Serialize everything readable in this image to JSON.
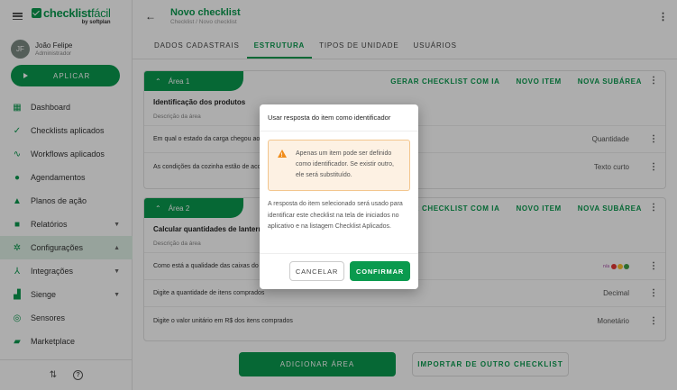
{
  "brand": {
    "logo_main": "checklist",
    "logo_light": "fácil",
    "logo_sub": "by softplan"
  },
  "user": {
    "initials": "JF",
    "name": "João Felipe",
    "role": "Administrador"
  },
  "sidebar": {
    "apply_label": "APLICAR",
    "items": [
      {
        "label": "Dashboard",
        "icon": "dashboard-icon"
      },
      {
        "label": "Checklists aplicados",
        "icon": "check-icon"
      },
      {
        "label": "Workflows aplicados",
        "icon": "trend-icon"
      },
      {
        "label": "Agendamentos",
        "icon": "clock-icon"
      },
      {
        "label": "Planos de ação",
        "icon": "warning-icon"
      },
      {
        "label": "Relatórios",
        "icon": "report-icon"
      },
      {
        "label": "Configurações",
        "icon": "gear-icon"
      },
      {
        "label": "Integrações",
        "icon": "integration-icon"
      },
      {
        "label": "Sienge",
        "icon": "building-icon"
      },
      {
        "label": "Sensores",
        "icon": "sensor-icon"
      },
      {
        "label": "Marketplace",
        "icon": "bag-icon"
      }
    ]
  },
  "header": {
    "title": "Novo checklist",
    "breadcrumb": "Checklist / Novo checklist"
  },
  "tabs": [
    "DADOS CADASTRAIS",
    "ESTRUTURA",
    "TIPOS DE UNIDADE",
    "USUÁRIOS"
  ],
  "area_actions": {
    "ai": "GERAR CHECKLIST COM IA",
    "new_item": "NOVO ITEM",
    "new_sub": "NOVA SUBÁREA"
  },
  "areas": [
    {
      "tab": "Área 1",
      "name": "Identificação dos produtos",
      "desc": "Descrição da área",
      "rows": [
        {
          "q": "Em qual o estado da carga chegou ao",
          "type": "Quantidade"
        },
        {
          "q": "As condições da cozinha estão de aco",
          "type": "Texto curto"
        }
      ]
    },
    {
      "tab": "Área 2",
      "name": "Calcular quantidades de lanternas",
      "desc": "Descrição da área",
      "rows": [
        {
          "q": "Como está a qualidade das caixas do",
          "type": "",
          "rating_label": "n/a"
        },
        {
          "q": "Digite a quantidade de itens comprados",
          "type": "Decimal"
        },
        {
          "q": "Digite o valor unitário em R$ dos itens comprados",
          "type": "Monetário"
        }
      ]
    }
  ],
  "footer": {
    "add_area": "ADICIONAR ÁREA",
    "import": "IMPORTAR DE OUTRO CHECKLIST"
  },
  "dialog": {
    "title": "Usar resposta do item como identificador",
    "warning": "Apenas um item pode ser definido como identificador. Se existir outro, ele será substituído.",
    "body": "A resposta do item selecionado será usado para identificar este checklist na tela de iniciados no aplicativo e na listagem Checklist Aplicados.",
    "cancel": "CANCELAR",
    "confirm": "CONFIRMAR"
  },
  "colors": {
    "brand": "#0a9a4e",
    "warning_bg": "#fdf1e3",
    "warning_icon": "#f08c1a"
  }
}
